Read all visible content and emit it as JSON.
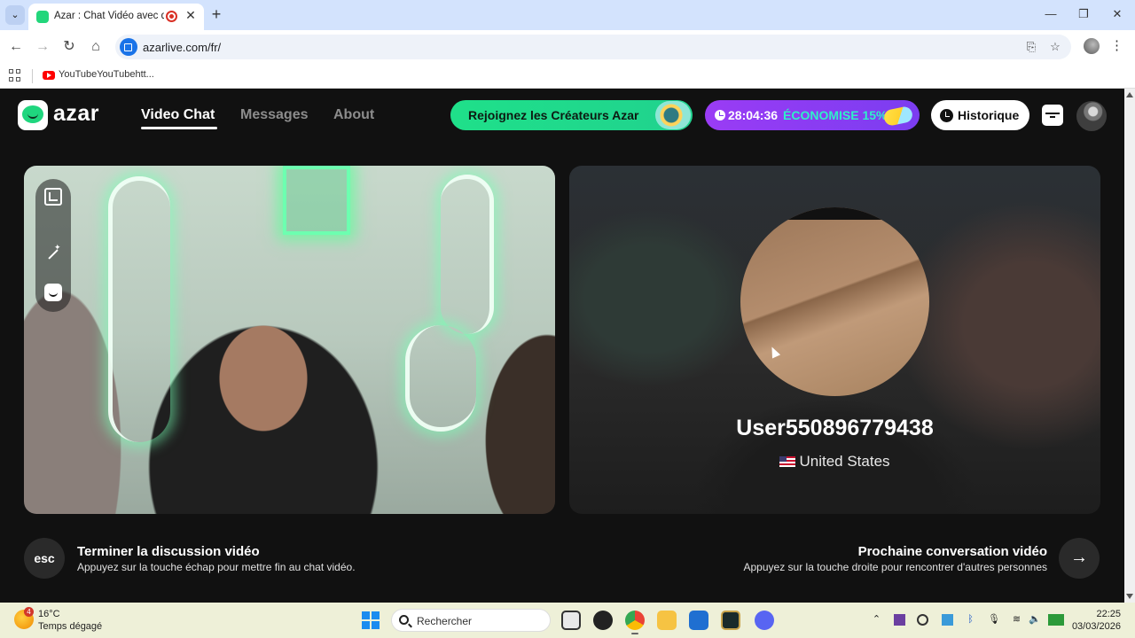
{
  "browser": {
    "tab_title": "Azar : Chat Vidéo avec de n",
    "tab_close": "✕",
    "new_tab": "+",
    "url": "azarlive.com/fr/",
    "bookmark_label": "YouTubeYouTubehtt...",
    "window_controls": {
      "minimize": "—",
      "restore": "❐",
      "close": "✕"
    },
    "nav": {
      "back": "←",
      "forward": "→",
      "reload": "↻",
      "home": "⌂"
    }
  },
  "header": {
    "logo_text": "azar",
    "nav": [
      {
        "label": "Video Chat",
        "active": true
      },
      {
        "label": "Messages",
        "active": false
      },
      {
        "label": "About",
        "active": false
      }
    ],
    "creators_label": "Rejoignez les Créateurs Azar",
    "promo_time": "28:04:36",
    "promo_save": "ÉCONOMISE 15%",
    "history_label": "Historique"
  },
  "remote": {
    "username": "User550896779438",
    "country": "United States"
  },
  "controls": {
    "esc_label": "esc",
    "end_title": "Terminer la discussion vidéo",
    "end_sub": "Appuyez sur la touche échap pour mettre fin au chat vidéo.",
    "next_title": "Prochaine conversation vidéo",
    "next_sub": "Appuyez sur la touche droite pour rencontrer d'autres personnes",
    "next_arrow": "→"
  },
  "taskbar": {
    "weather_badge": "4",
    "weather_temp": "16°C",
    "weather_desc": "Temps dégagé",
    "search_label": "Rechercher",
    "time": "22:25",
    "date": "03/03/2026"
  },
  "colors": {
    "accent_green": "#1fd67e",
    "promo_purple": "#8a3cf2",
    "promo_teal": "#2ff0c8"
  }
}
